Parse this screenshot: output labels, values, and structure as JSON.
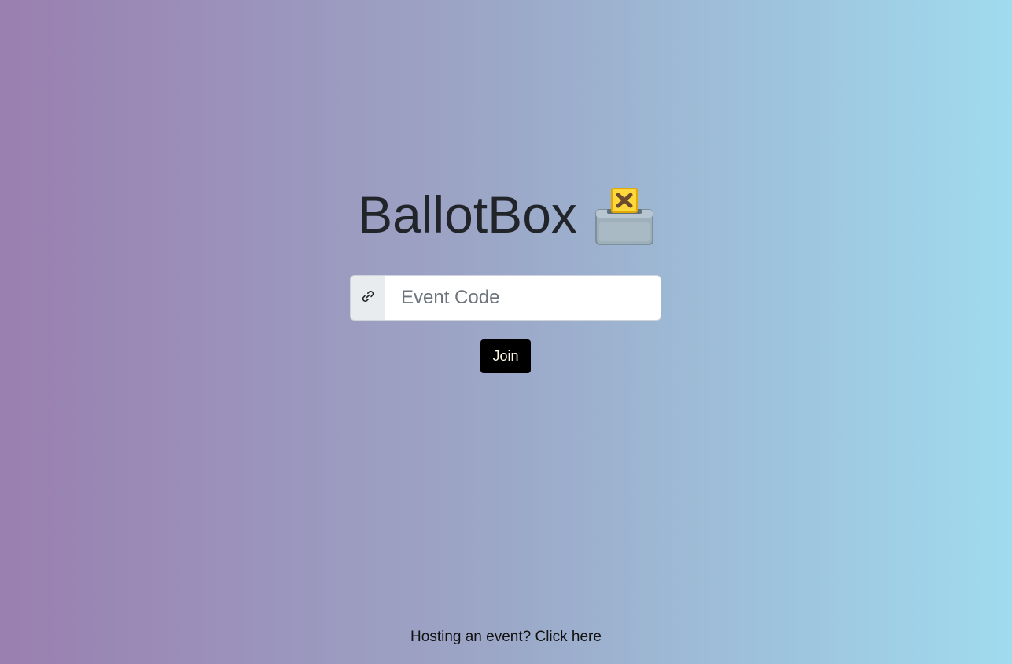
{
  "app": {
    "title": "BallotBox",
    "logo_icon": "ballot-box-with-ballot-icon"
  },
  "join_form": {
    "prefix_icon": "link-icon",
    "input_placeholder": "Event Code",
    "input_value": "",
    "join_label": "Join"
  },
  "footer": {
    "host_link_text": "Hosting an event? Click here"
  },
  "colors": {
    "gradient_start": "#9a7faf",
    "gradient_end": "#a0dbee",
    "button_bg": "#000000"
  }
}
